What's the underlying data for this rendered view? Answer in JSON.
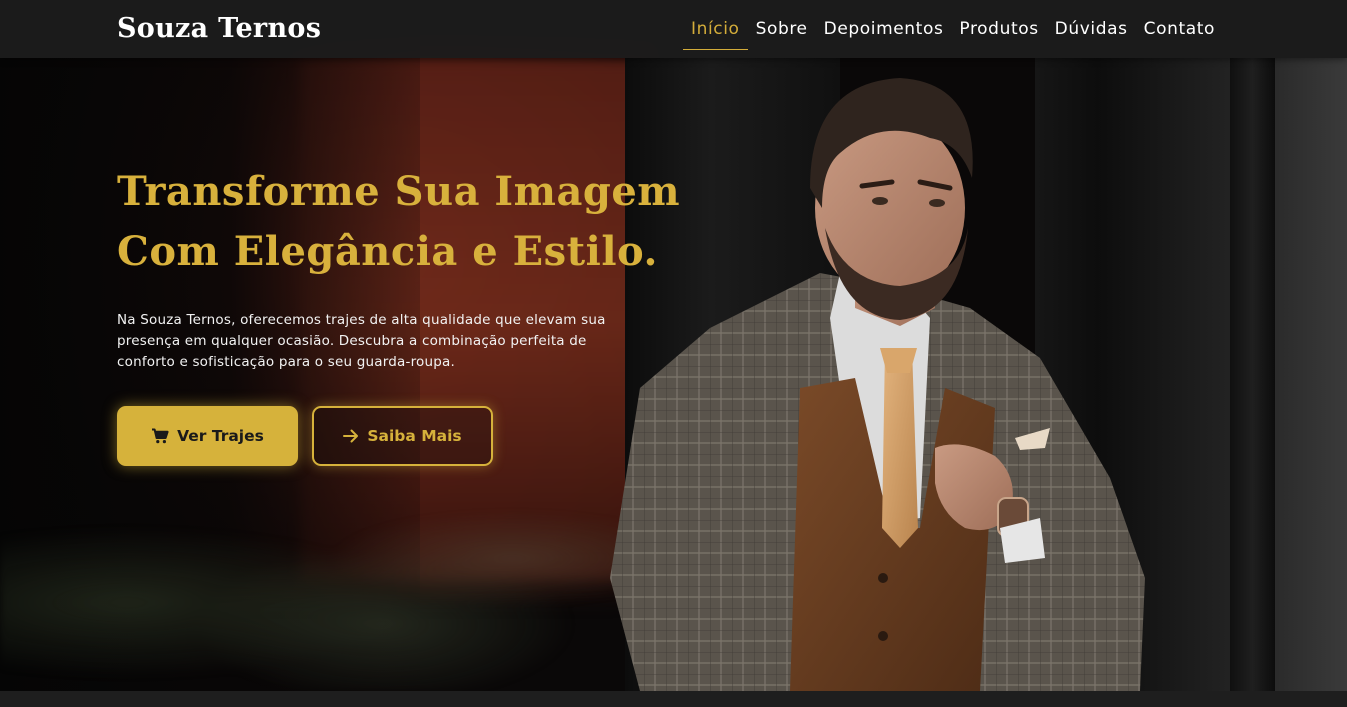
{
  "brand": {
    "name": "Souza Ternos"
  },
  "nav": {
    "items": [
      {
        "label": "Início",
        "active": true
      },
      {
        "label": "Sobre",
        "active": false
      },
      {
        "label": "Depoimentos",
        "active": false
      },
      {
        "label": "Produtos",
        "active": false
      },
      {
        "label": "Dúvidas",
        "active": false
      },
      {
        "label": "Contato",
        "active": false
      }
    ]
  },
  "hero": {
    "headline_line1": "Transforme Sua Imagem",
    "headline_line2": "Com Elegância e Estilo.",
    "lead": "Na Souza Ternos, oferecemos trajes de alta qualidade que elevam sua presença em qualquer ocasião. Descubra a combinação perfeita de conforto e sofisticação para o seu guarda-roupa.",
    "primary_button": {
      "label": "Ver Trajes",
      "icon": "cart-icon"
    },
    "secondary_button": {
      "label": "Saiba Mais",
      "icon": "arrow-right-icon"
    },
    "image_alt": "man-in-plaid-suit-photo"
  },
  "colors": {
    "accent": "#d6b23b",
    "nav_bg": "#1c1c1c",
    "text": "#ffffff"
  }
}
